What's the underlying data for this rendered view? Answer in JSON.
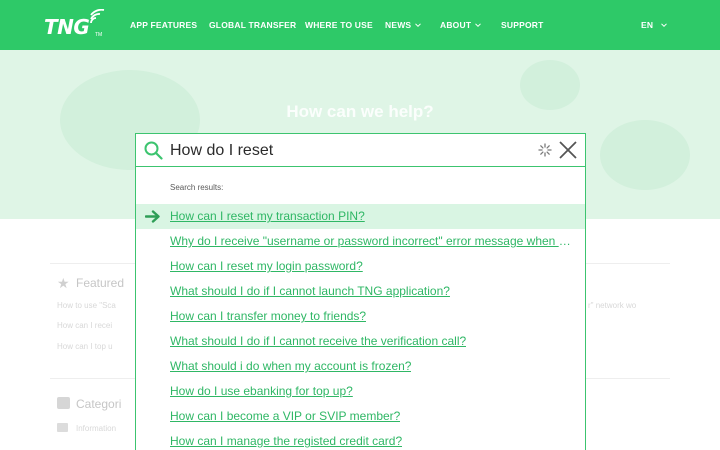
{
  "brand": {
    "logo_text": "TNG",
    "logo_tm": "TM"
  },
  "nav": {
    "items": [
      {
        "label": "APP FEATURES"
      },
      {
        "label": "GLOBAL TRANSFER"
      },
      {
        "label": "WHERE TO USE"
      },
      {
        "label": "NEWS"
      },
      {
        "label": "ABOUT"
      },
      {
        "label": "SUPPORT"
      }
    ],
    "language": "EN"
  },
  "hero": {
    "title": "How can we help?"
  },
  "background": {
    "featured_heading": "Featured",
    "featured_lines": [
      "How to use \"Sca",
      "How can I recei",
      "How can I top u"
    ],
    "featured_right": "r\" network wo",
    "category_heading": "Categori",
    "category_item": "Information"
  },
  "search": {
    "value": "How do I reset",
    "placeholder": "",
    "results_label": "Search results:",
    "results": [
      "How can I reset my transaction PIN?",
      "Why do I receive \"username or password incorrect\" error message when login?",
      "How can I reset my login password?",
      "What should I do if I cannot launch TNG application?",
      "How can I transfer money to friends?",
      "What should I do if I cannot receive the verification call?",
      "What should i do when my account is frozen?",
      "How do I use ebanking for top up?",
      "How can I become a VIP or SVIP member?",
      "How can I manage the registed credit card?"
    ]
  },
  "colors": {
    "brand_green": "#2ec968",
    "link_green": "#2fb765",
    "highlight": "#d9f5e3"
  }
}
